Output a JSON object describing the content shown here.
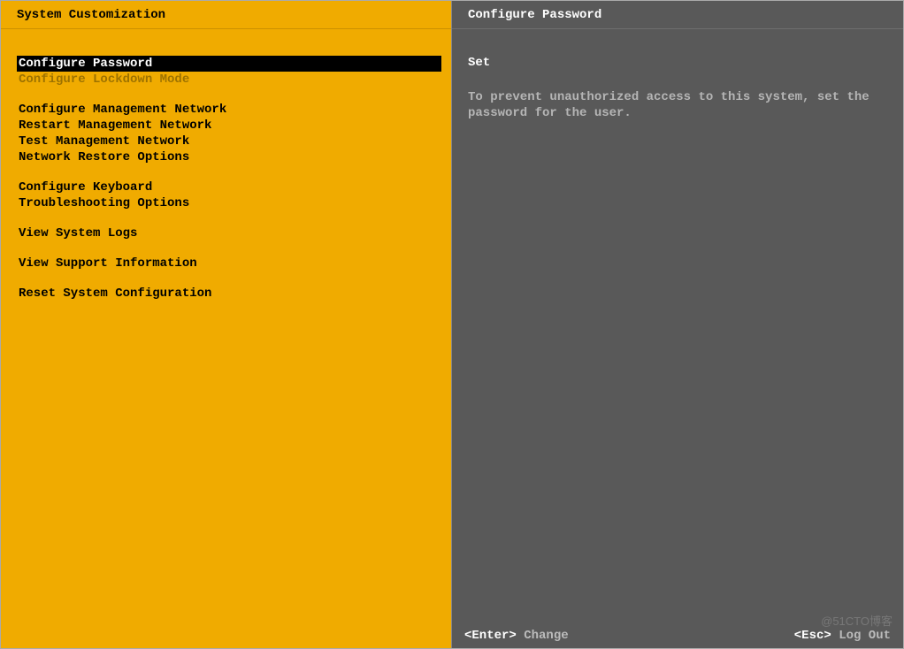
{
  "left": {
    "title": "System Customization",
    "groups": [
      [
        {
          "label": "Configure Password",
          "selected": true,
          "disabled": false
        },
        {
          "label": "Configure Lockdown Mode",
          "selected": false,
          "disabled": true
        }
      ],
      [
        {
          "label": "Configure Management Network",
          "selected": false,
          "disabled": false
        },
        {
          "label": "Restart Management Network",
          "selected": false,
          "disabled": false
        },
        {
          "label": "Test Management Network",
          "selected": false,
          "disabled": false
        },
        {
          "label": "Network Restore Options",
          "selected": false,
          "disabled": false
        }
      ],
      [
        {
          "label": "Configure Keyboard",
          "selected": false,
          "disabled": false
        },
        {
          "label": "Troubleshooting Options",
          "selected": false,
          "disabled": false
        }
      ],
      [
        {
          "label": "View System Logs",
          "selected": false,
          "disabled": false
        }
      ],
      [
        {
          "label": "View Support Information",
          "selected": false,
          "disabled": false
        }
      ],
      [
        {
          "label": "Reset System Configuration",
          "selected": false,
          "disabled": false
        }
      ]
    ]
  },
  "right": {
    "title": "Configure Password",
    "status": "Set",
    "description": "To prevent unauthorized access to this system, set the password for the user."
  },
  "footer": {
    "enter_key": "<Enter>",
    "enter_label": "Change",
    "esc_key": "<Esc>",
    "esc_label": "Log Out"
  },
  "watermark": "@51CTO博客"
}
